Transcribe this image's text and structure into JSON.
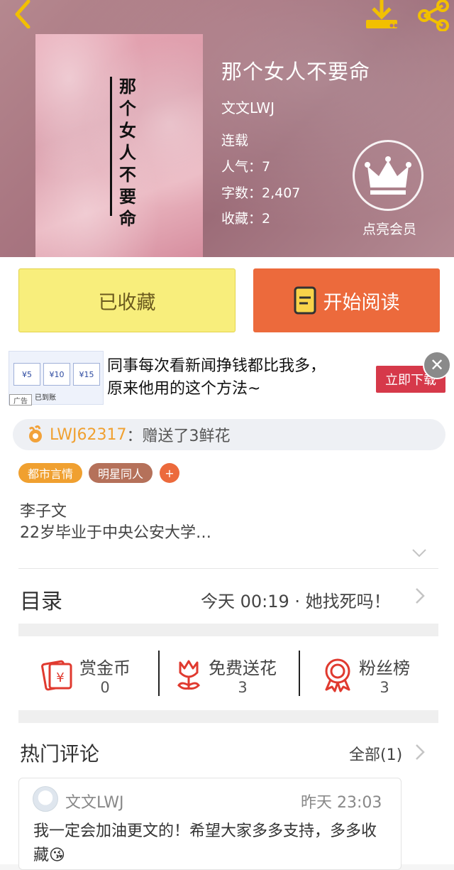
{
  "header": {
    "cover_text": "那个女人不要命",
    "title": "那个女人不要命",
    "author": "文文LWJ",
    "status": "连载",
    "popularity": "人气：7",
    "word_count": "字数：2,407",
    "favorites": "收藏：2",
    "vip_label": "点亮会员"
  },
  "actions": {
    "collected_label": "已收藏",
    "read_label": "开始阅读"
  },
  "ad": {
    "text_line1": "同事每次看新闻挣钱都比我多，",
    "text_line2": "原来他用的这个方法~",
    "button_label": "立即下载",
    "badge": "广告",
    "thumb_values": [
      "¥5",
      "¥10",
      "¥15"
    ],
    "thumb_caption": "已到账"
  },
  "gift": {
    "user": "LWJ62317",
    "text": "：赠送了3鲜花"
  },
  "tags": [
    "都市言情",
    "明星同人",
    "+"
  ],
  "intro": {
    "line1": "李子文",
    "line2": "22岁毕业于中央公安大学…"
  },
  "toc": {
    "label": "目录",
    "latest": "今天 00:19 · 她找死吗！"
  },
  "stats": [
    {
      "label": "赏金币",
      "value": "0"
    },
    {
      "label": "免费送花",
      "value": "3"
    },
    {
      "label": "粉丝榜",
      "value": "3"
    }
  ],
  "comments": {
    "label": "热门评论",
    "all": "全部(1)",
    "items": [
      {
        "user": "文文LWJ",
        "time": "昨天 23:03",
        "text": "我一定会加油更文的！希望大家多多支持，多多收藏😘"
      }
    ]
  },
  "colors": {
    "accent_orange": "#ec6a3c",
    "collect_yellow": "#f8ee7c",
    "gift_user": "#f0a030",
    "icon_red": "#e03a2f"
  }
}
